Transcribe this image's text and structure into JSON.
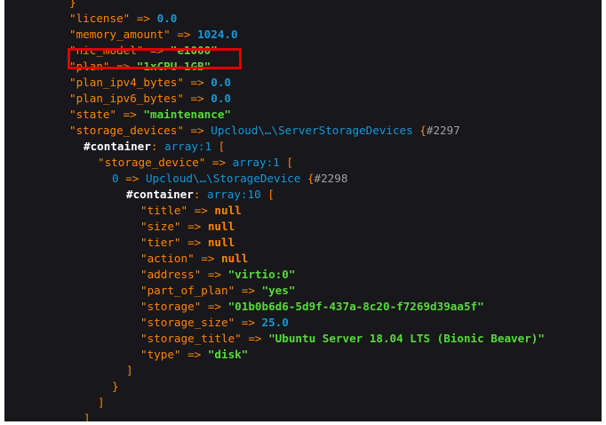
{
  "lines": [
    {
      "indent": 0,
      "parts": [
        {
          "t": "}",
          "c": "k"
        }
      ]
    },
    {
      "indent": 0,
      "parts": [
        {
          "t": "\"license\"",
          "c": "k"
        },
        {
          "t": " => ",
          "c": "op"
        },
        {
          "t": "0.0",
          "c": "num"
        }
      ]
    },
    {
      "indent": 0,
      "parts": [
        {
          "t": "\"memory_amount\"",
          "c": "k"
        },
        {
          "t": " => ",
          "c": "op"
        },
        {
          "t": "1024.0",
          "c": "num"
        }
      ]
    },
    {
      "indent": 0,
      "parts": [
        {
          "t": "\"nic_model\"",
          "c": "k"
        },
        {
          "t": " => ",
          "c": "op"
        },
        {
          "t": "\"e1000\"",
          "c": "str"
        }
      ]
    },
    {
      "indent": 0,
      "parts": [
        {
          "t": "\"plan\"",
          "c": "k"
        },
        {
          "t": " => ",
          "c": "op"
        },
        {
          "t": "\"1xCPU-1GB\"",
          "c": "str"
        }
      ]
    },
    {
      "indent": 0,
      "parts": [
        {
          "t": "\"plan_ipv4_bytes\"",
          "c": "k"
        },
        {
          "t": " => ",
          "c": "op"
        },
        {
          "t": "0.0",
          "c": "num"
        }
      ]
    },
    {
      "indent": 0,
      "parts": [
        {
          "t": "\"plan_ipv6_bytes\"",
          "c": "k"
        },
        {
          "t": " => ",
          "c": "op"
        },
        {
          "t": "0.0",
          "c": "num"
        }
      ]
    },
    {
      "indent": 0,
      "parts": [
        {
          "t": "\"state\"",
          "c": "k"
        },
        {
          "t": " => ",
          "c": "op"
        },
        {
          "t": "\"maintenance\"",
          "c": "str"
        }
      ]
    },
    {
      "indent": 0,
      "parts": [
        {
          "t": "\"storage_devices\"",
          "c": "k"
        },
        {
          "t": " => ",
          "c": "op"
        },
        {
          "t": "Upcloud\\…\\ServerStorageDevices",
          "c": "cls"
        },
        {
          "t": " {",
          "c": "k"
        },
        {
          "t": "#2297",
          "c": "ref"
        }
      ]
    },
    {
      "indent": 1,
      "parts": [
        {
          "t": "#container",
          "c": "prop"
        },
        {
          "t": ": ",
          "c": "k"
        },
        {
          "t": "array:1",
          "c": "cls"
        },
        {
          "t": " [",
          "c": "k"
        }
      ]
    },
    {
      "indent": 2,
      "parts": [
        {
          "t": "\"storage_device\"",
          "c": "k"
        },
        {
          "t": " => ",
          "c": "op"
        },
        {
          "t": "array:1",
          "c": "cls"
        },
        {
          "t": " [",
          "c": "k"
        }
      ]
    },
    {
      "indent": 3,
      "parts": [
        {
          "t": "0",
          "c": "cls"
        },
        {
          "t": " => ",
          "c": "op"
        },
        {
          "t": "Upcloud\\…\\StorageDevice",
          "c": "cls"
        },
        {
          "t": " {",
          "c": "k"
        },
        {
          "t": "#2298",
          "c": "ref"
        }
      ]
    },
    {
      "indent": 4,
      "parts": [
        {
          "t": "#container",
          "c": "prop"
        },
        {
          "t": ": ",
          "c": "k"
        },
        {
          "t": "array:10",
          "c": "cls"
        },
        {
          "t": " [",
          "c": "k"
        }
      ]
    },
    {
      "indent": 5,
      "parts": [
        {
          "t": "\"title\"",
          "c": "k"
        },
        {
          "t": " => ",
          "c": "op"
        },
        {
          "t": "null",
          "c": "kw"
        }
      ]
    },
    {
      "indent": 5,
      "parts": [
        {
          "t": "\"size\"",
          "c": "k"
        },
        {
          "t": " => ",
          "c": "op"
        },
        {
          "t": "null",
          "c": "kw"
        }
      ]
    },
    {
      "indent": 5,
      "parts": [
        {
          "t": "\"tier\"",
          "c": "k"
        },
        {
          "t": " => ",
          "c": "op"
        },
        {
          "t": "null",
          "c": "kw"
        }
      ]
    },
    {
      "indent": 5,
      "parts": [
        {
          "t": "\"action\"",
          "c": "k"
        },
        {
          "t": " => ",
          "c": "op"
        },
        {
          "t": "null",
          "c": "kw"
        }
      ]
    },
    {
      "indent": 5,
      "parts": [
        {
          "t": "\"address\"",
          "c": "k"
        },
        {
          "t": " => ",
          "c": "op"
        },
        {
          "t": "\"virtio:0\"",
          "c": "str"
        }
      ]
    },
    {
      "indent": 5,
      "parts": [
        {
          "t": "\"part_of_plan\"",
          "c": "k"
        },
        {
          "t": " => ",
          "c": "op"
        },
        {
          "t": "\"yes\"",
          "c": "str"
        }
      ]
    },
    {
      "indent": 5,
      "parts": [
        {
          "t": "\"storage\"",
          "c": "k"
        },
        {
          "t": " => ",
          "c": "op"
        },
        {
          "t": "\"01b0b6d6-5d9f-437a-8c20-f7269d39aa5f\"",
          "c": "str"
        }
      ]
    },
    {
      "indent": 5,
      "parts": [
        {
          "t": "\"storage_size\"",
          "c": "k"
        },
        {
          "t": " => ",
          "c": "op"
        },
        {
          "t": "25.0",
          "c": "num"
        }
      ]
    },
    {
      "indent": 5,
      "parts": [
        {
          "t": "\"storage_title\"",
          "c": "k"
        },
        {
          "t": " => ",
          "c": "op"
        },
        {
          "t": "\"Ubuntu Server 18.04 LTS (Bionic Beaver)\"",
          "c": "str"
        }
      ]
    },
    {
      "indent": 5,
      "parts": [
        {
          "t": "\"type\"",
          "c": "k"
        },
        {
          "t": " => ",
          "c": "op"
        },
        {
          "t": "\"disk\"",
          "c": "str"
        }
      ]
    },
    {
      "indent": 4,
      "parts": [
        {
          "t": "]",
          "c": "k"
        }
      ]
    },
    {
      "indent": 3,
      "parts": [
        {
          "t": "}",
          "c": "k"
        }
      ]
    },
    {
      "indent": 2,
      "parts": [
        {
          "t": "]",
          "c": "k"
        }
      ]
    },
    {
      "indent": 1,
      "parts": [
        {
          "t": "]",
          "c": "k"
        }
      ]
    }
  ],
  "highlighted_line_index": 3,
  "colors": {
    "background": "#18171b",
    "key": "#ff8400",
    "number": "#1299da",
    "string": "#56db3a",
    "class": "#1299da",
    "highlight_border": "#e00000"
  }
}
